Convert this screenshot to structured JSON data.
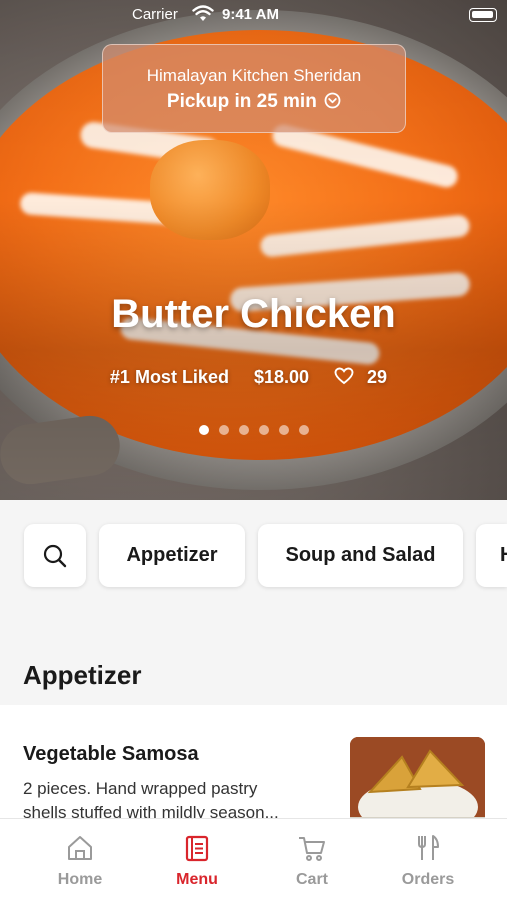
{
  "status_bar": {
    "carrier": "Carrier",
    "time": "9:41 AM"
  },
  "pickup": {
    "restaurant": "Himalayan Kitchen Sheridan",
    "pickup_time": "Pickup in 25 min"
  },
  "featured": {
    "dish_name": "Butter Chicken",
    "badge": "#1 Most Liked",
    "price": "$18.00",
    "likes": "29",
    "carousel_count": 6,
    "carousel_active": 0
  },
  "categories": {
    "items": [
      "Appetizer",
      "Soup and Salad",
      "H"
    ]
  },
  "section": {
    "title": "Appetizer",
    "items": [
      {
        "name": "Vegetable Samosa",
        "desc_line1": "2 pieces. Hand wrapped pastry",
        "desc_line2": "shells stuffed with mildly season..."
      }
    ]
  },
  "tabbar": {
    "tabs": [
      {
        "label": "Home",
        "icon": "home-icon"
      },
      {
        "label": "Menu",
        "icon": "menu-icon"
      },
      {
        "label": "Cart",
        "icon": "cart-icon"
      },
      {
        "label": "Orders",
        "icon": "orders-icon"
      }
    ],
    "active": "Menu"
  },
  "colors": {
    "accent": "#d9252c",
    "inactive": "#9a9a9a",
    "pill_bg": "#ffffff",
    "page_bg": "#f5f5f5"
  }
}
